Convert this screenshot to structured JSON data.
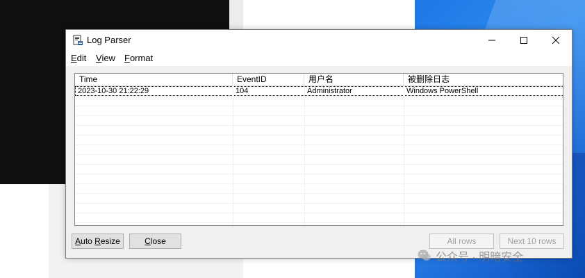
{
  "window": {
    "title": "Log Parser",
    "controls": {
      "minimize": "minimize",
      "maximize": "maximize",
      "close": "close"
    }
  },
  "menu": {
    "edit": {
      "first": "E",
      "rest": "dit"
    },
    "view": {
      "first": "V",
      "rest": "iew"
    },
    "format": {
      "first": "F",
      "rest": "ormat"
    }
  },
  "table": {
    "columns": [
      "Time",
      "EventID",
      "用户名",
      "被删除日志"
    ],
    "rows": [
      [
        "2023-10-30 21:22:29",
        "104",
        "Administrator",
        "Windows PowerShell"
      ]
    ]
  },
  "buttons": {
    "auto_resize": {
      "first": "A",
      "rest": "uto ",
      "u2": "R",
      "rest2": "esize"
    },
    "close": {
      "first": "C",
      "rest": "lose"
    },
    "all_rows": "All rows",
    "next_rows": "Next 10 rows"
  },
  "watermark": {
    "text": "公众号 · 明暗安全"
  },
  "colors": {
    "desktop_blue": "#1e78e6",
    "window_bg": "#f0f0f0",
    "disabled_text": "#a0a0a0"
  }
}
